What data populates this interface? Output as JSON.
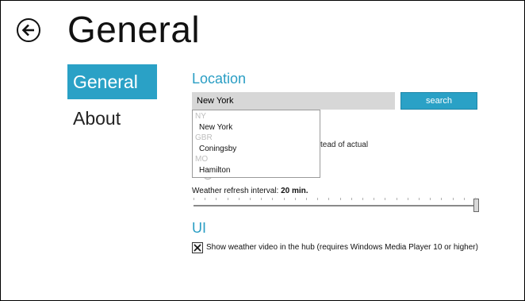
{
  "page": {
    "title": "General"
  },
  "nav": {
    "items": [
      {
        "label": "General",
        "selected": true
      },
      {
        "label": "About",
        "selected": false
      }
    ]
  },
  "location": {
    "heading": "Location",
    "input_value": "New York",
    "search_label": "search",
    "partial_text": "stead of actual",
    "suggestions": [
      {
        "group": "NY",
        "item": "New York"
      },
      {
        "group": "GBR",
        "item": "Coningsby"
      },
      {
        "group": "MO",
        "item": "Hamilton"
      }
    ]
  },
  "refresh": {
    "label_prefix": "Weather refresh interval: ",
    "value_text": "20 min.",
    "slider_fraction": 1.0,
    "tick_count": 26
  },
  "ui": {
    "heading": "UI",
    "video_checkbox_label": "Show weather video in the hub (requires Windows Media Player 10 or higher)",
    "video_checked": true
  },
  "colors": {
    "accent": "#2aa1c6",
    "heading": "#2a9ec4",
    "input_bg": "#d7d7d7"
  },
  "icons": {
    "back": "back-arrow-icon",
    "check": "x-check-icon"
  }
}
